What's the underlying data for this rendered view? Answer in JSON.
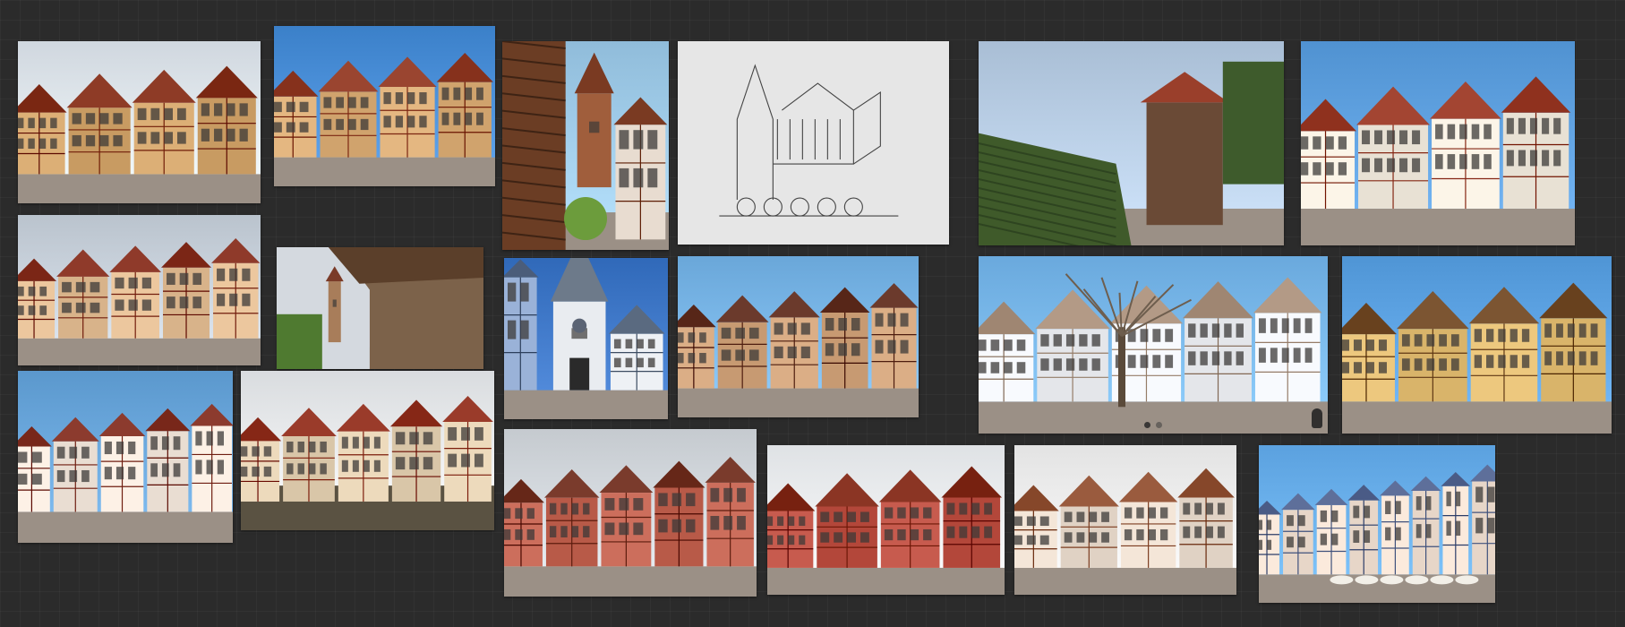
{
  "canvas": {
    "background": "#2b2b2b",
    "grid_line": "rgba(255,255,255,0.035)"
  },
  "images": [
    {
      "id": "rothenburg-plonlein-wide",
      "kind": "photo-street",
      "sky": "#dfe6ee",
      "wall": "#c89b62",
      "roof": "#8e3b26"
    },
    {
      "id": "rothenburg-plonlein-blue-sky",
      "kind": "photo-street",
      "sky": "#4a8fd8",
      "wall": "#d0a36d",
      "roof": "#9a4530"
    },
    {
      "id": "wall-walk-tower",
      "kind": "photo-tower",
      "sky": "#9fcbe9",
      "wall": "#a05e3c",
      "roof": "#7a3a22"
    },
    {
      "id": "castle-pencil-sketch",
      "kind": "sketch",
      "sky": "#e6e6e6",
      "wall": "#bdbdbd",
      "roof": "#888888"
    },
    {
      "id": "castle-vineyard-hill",
      "kind": "photo-castle",
      "sky": "#b8cde4",
      "wall": "#6a4a36",
      "roof": "#9a3f2b"
    },
    {
      "id": "half-timbered-street-close",
      "kind": "photo-street",
      "sky": "#5fa1e0",
      "wall": "#e8e1d4",
      "roof": "#a34532"
    },
    {
      "id": "market-square-half-timbered",
      "kind": "photo-square",
      "sky": "#c9d2dc",
      "wall": "#d8b38a",
      "roof": "#8f3a2a"
    },
    {
      "id": "covered-wall-walk",
      "kind": "photo-walkway",
      "sky": "#c4ccd6",
      "wall": "#7c624a",
      "roof": "#5b3f2a"
    },
    {
      "id": "gate-tower-clock",
      "kind": "photo-gate",
      "sky": "#3f78c8",
      "wall": "#e9ecf0",
      "roof": "#6d7a8a"
    },
    {
      "id": "town-hall-square",
      "kind": "photo-square",
      "sky": "#79b6e8",
      "wall": "#c79a72",
      "roof": "#6b3a2c"
    },
    {
      "id": "panorama-square-tree",
      "kind": "photo-square",
      "sky": "#79b8ec",
      "wall": "#e4e6ea",
      "roof": "#b39a86"
    },
    {
      "id": "yellow-timber-street",
      "kind": "photo-street",
      "sky": "#5ea4e4",
      "wall": "#d9b46a",
      "roof": "#7c5532"
    },
    {
      "id": "corner-house-green",
      "kind": "photo-square",
      "sky": "#6aa7dc",
      "wall": "#e9ddd2",
      "roof": "#8c3b2e"
    },
    {
      "id": "river-canal-houses",
      "kind": "photo-river",
      "sky": "#e8ebee",
      "wall": "#d9c6a8",
      "roof": "#9a3b2a"
    },
    {
      "id": "esslingen-old-town-hall",
      "kind": "photo-square",
      "sky": "#d4d9de",
      "wall": "#b85a48",
      "roof": "#7a3b2c"
    },
    {
      "id": "red-timber-lane",
      "kind": "photo-street",
      "sky": "#eef1f4",
      "wall": "#b3473a",
      "roof": "#8b3524"
    },
    {
      "id": "alley-stone-arch",
      "kind": "photo-street",
      "sky": "#f2f2f2",
      "wall": "#e0d2c4",
      "roof": "#9a5b3e"
    },
    {
      "id": "colourful-market-row",
      "kind": "photo-row",
      "sky": "#6ab0ee",
      "wall": "#e7d6c8",
      "roof": "#5e6f9a"
    }
  ],
  "street_view_controls": {
    "dots": [
      "dot-1",
      "dot-2"
    ],
    "pegman": "pegman-icon"
  }
}
